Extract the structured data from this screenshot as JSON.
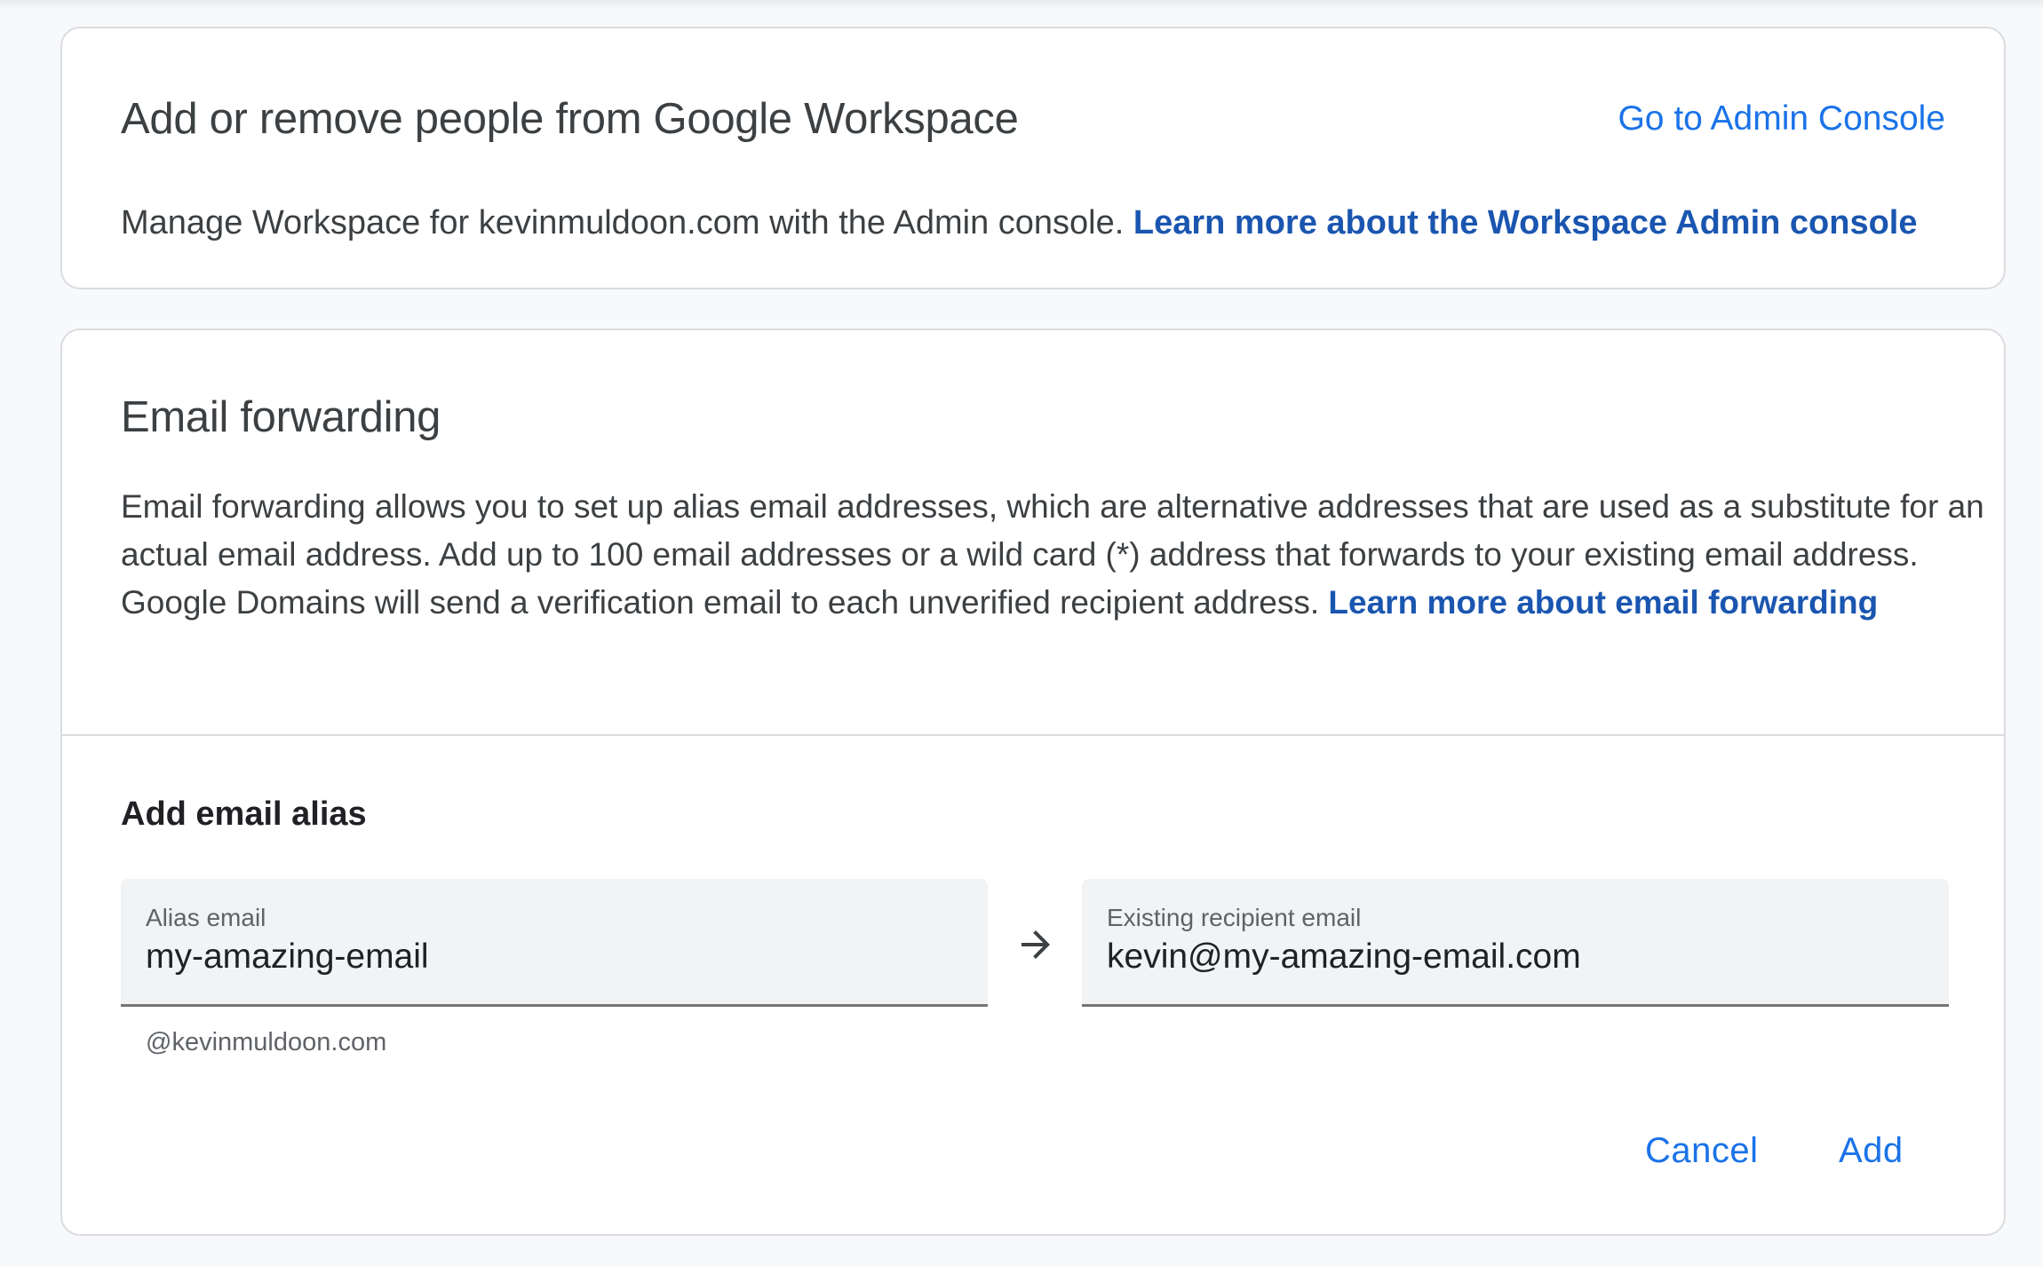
{
  "workspace": {
    "title": "Add or remove people from Google Workspace",
    "admin_link": "Go to Admin Console",
    "description": "Manage Workspace for kevinmuldoon.com with the Admin console.",
    "learn_more": "Learn more about the Workspace Admin console"
  },
  "forwarding": {
    "title": "Email forwarding",
    "description": "Email forwarding allows you to set up alias email addresses, which are alternative addresses that are used as a substitute for an actual email address. Add up to 100 email addresses or a wild card (*) address that forwards to your existing email address. Google Domains will send a verification email to each unverified recipient address.",
    "learn_more": "Learn more about email forwarding",
    "add_alias": {
      "heading": "Add email alias",
      "alias_field": {
        "label": "Alias email",
        "value": "my-amazing-email",
        "hint": "@kevinmuldoon.com"
      },
      "recipient_field": {
        "label": "Existing recipient email",
        "value": "kevin@my-amazing-email.com"
      },
      "arrow_icon": "arrow-right-icon",
      "cancel_label": "Cancel",
      "add_label": "Add"
    }
  },
  "colors": {
    "link": "#1a73e8",
    "link_strong": "#1a56b0",
    "field_bg": "#f1f3f4",
    "border": "#dadce0"
  }
}
